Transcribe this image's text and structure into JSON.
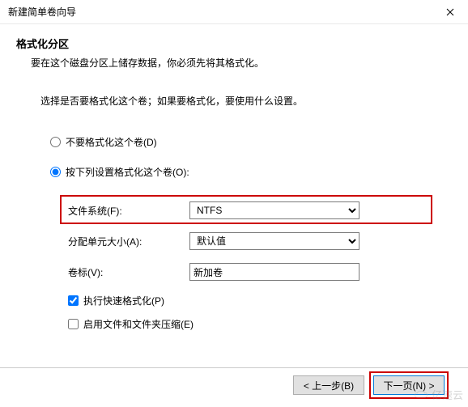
{
  "window": {
    "title": "新建简单卷向导"
  },
  "header": {
    "title": "格式化分区",
    "subtitle": "要在这个磁盘分区上储存数据，你必须先将其格式化。"
  },
  "instruction": "选择是否要格式化这个卷；如果要格式化，要使用什么设置。",
  "options": {
    "no_format": "不要格式化这个卷(D)",
    "do_format": "按下列设置格式化这个卷(O):"
  },
  "fields": {
    "fs_label": "文件系统(F):",
    "fs_value": "NTFS",
    "alloc_label": "分配单元大小(A):",
    "alloc_value": "默认值",
    "vol_label": "卷标(V):",
    "vol_value": "新加卷",
    "quick_format": "执行快速格式化(P)",
    "compression": "启用文件和文件夹压缩(E)"
  },
  "buttons": {
    "back": "< 上一步(B)",
    "next": "下一页(N) >"
  },
  "watermark": "亿速云"
}
